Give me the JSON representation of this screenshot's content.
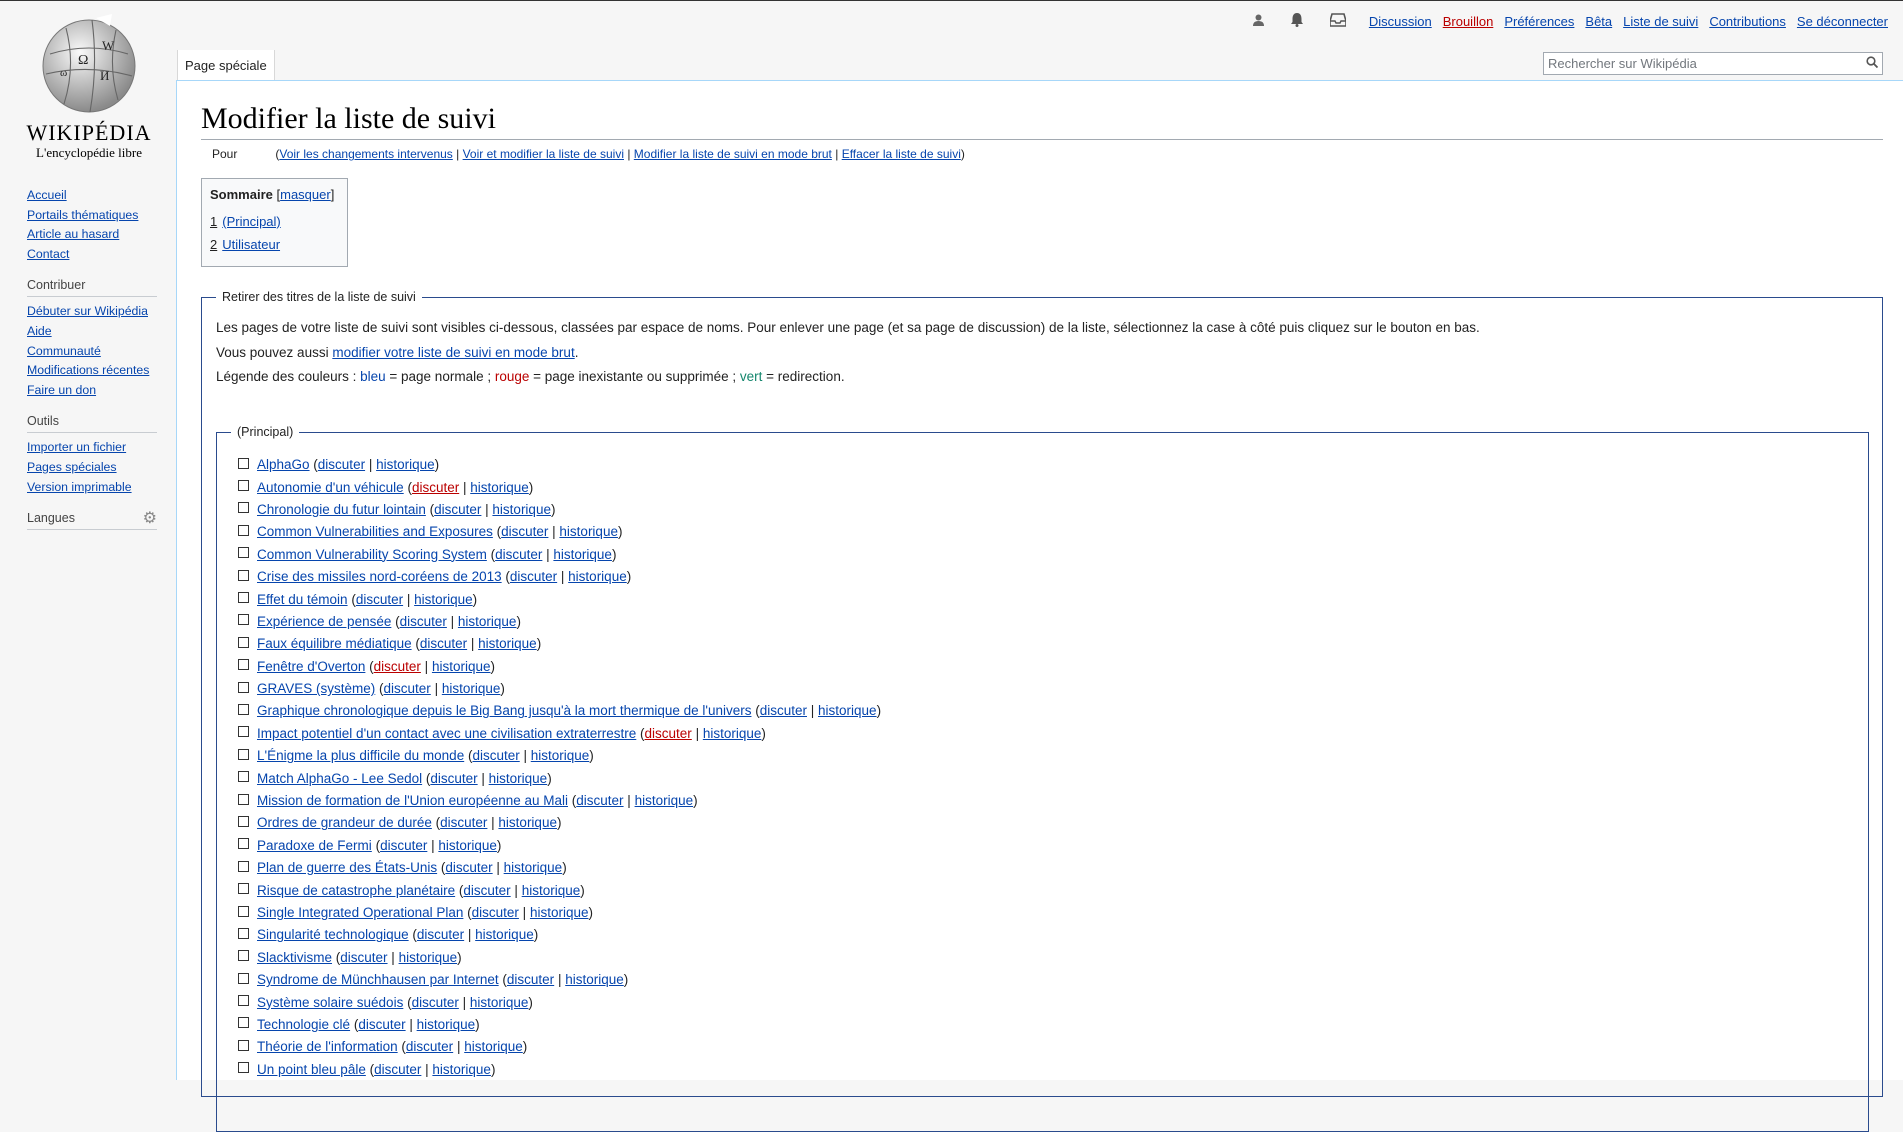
{
  "personal": {
    "items": [
      {
        "label": "Discussion",
        "red": false
      },
      {
        "label": "Brouillon",
        "red": true
      },
      {
        "label": "Préférences",
        "red": false
      },
      {
        "label": "Bêta",
        "red": false
      },
      {
        "label": "Liste de suivi",
        "red": false
      },
      {
        "label": "Contributions",
        "red": false
      },
      {
        "label": "Se déconnecter",
        "red": false
      }
    ]
  },
  "logo": {
    "wordmark": "WIKIPÉDIA",
    "tagline": "L'encyclopédie libre"
  },
  "sidebar": {
    "navigation": [
      "Accueil",
      "Portails thématiques",
      "Article au hasard",
      "Contact"
    ],
    "contribute": {
      "heading": "Contribuer",
      "items": [
        "Débuter sur Wikipédia",
        "Aide",
        "Communauté",
        "Modifications récentes",
        "Faire un don"
      ]
    },
    "tools": {
      "heading": "Outils",
      "items": [
        "Importer un fichier",
        "Pages spéciales",
        "Version imprimable"
      ]
    },
    "languages": {
      "heading": "Langues"
    }
  },
  "tabs": {
    "special": "Page spéciale"
  },
  "search": {
    "placeholder": "Rechercher sur Wikipédia"
  },
  "page": {
    "title": "Modifier la liste de suivi",
    "subnav": {
      "for": "Pour",
      "links": [
        "Voir les changements intervenus",
        "Voir et modifier la liste de suivi",
        "Modifier la liste de suivi en mode brut",
        "Effacer la liste de suivi"
      ]
    },
    "toc": {
      "title": "Sommaire",
      "toggle": "masquer",
      "items": [
        {
          "num": "1",
          "label": "(Principal)"
        },
        {
          "num": "2",
          "label": "Utilisateur"
        }
      ]
    },
    "remove": {
      "legend": "Retirer des titres de la liste de suivi",
      "intro": "Les pages de votre liste de suivi sont visibles ci-dessous, classées par espace de noms. Pour enlever une page (et sa page de discussion) de la liste, sélectionnez la case à côté puis cliquez sur le bouton en bas.",
      "raw_prefix": "Vous pouvez aussi ",
      "raw_link": "modifier votre liste de suivi en mode brut",
      "raw_suffix": ".",
      "legend_colors": {
        "prefix": "Légende des couleurs : ",
        "blue": "bleu",
        "blue_desc": " = page normale ; ",
        "red": "rouge",
        "red_desc": " = page inexistante ou supprimée ; ",
        "green": "vert",
        "green_desc": " = redirection."
      },
      "ns_legend": "(Principal)",
      "talk_label": "discuter",
      "history_label": "historique",
      "items": [
        {
          "title": "AlphaGo",
          "talk_red": false
        },
        {
          "title": "Autonomie d'un véhicule",
          "talk_red": true
        },
        {
          "title": "Chronologie du futur lointain",
          "talk_red": false
        },
        {
          "title": "Common Vulnerabilities and Exposures",
          "talk_red": false
        },
        {
          "title": "Common Vulnerability Scoring System",
          "talk_red": false
        },
        {
          "title": "Crise des missiles nord-coréens de 2013",
          "talk_red": false
        },
        {
          "title": "Effet du témoin",
          "talk_red": false
        },
        {
          "title": "Expérience de pensée",
          "talk_red": false
        },
        {
          "title": "Faux équilibre médiatique",
          "talk_red": false
        },
        {
          "title": "Fenêtre d'Overton",
          "talk_red": true
        },
        {
          "title": "GRAVES (système)",
          "talk_red": false
        },
        {
          "title": "Graphique chronologique depuis le Big Bang jusqu'à la mort thermique de l'univers",
          "talk_red": false
        },
        {
          "title": "Impact potentiel d'un contact avec une civilisation extraterrestre",
          "talk_red": true
        },
        {
          "title": "L'Énigme la plus difficile du monde",
          "talk_red": false
        },
        {
          "title": "Match AlphaGo - Lee Sedol",
          "talk_red": false
        },
        {
          "title": "Mission de formation de l'Union européenne au Mali",
          "talk_red": false
        },
        {
          "title": "Ordres de grandeur de durée",
          "talk_red": false
        },
        {
          "title": "Paradoxe de Fermi",
          "talk_red": false
        },
        {
          "title": "Plan de guerre des États-Unis",
          "talk_red": false
        },
        {
          "title": "Risque de catastrophe planétaire",
          "talk_red": false
        },
        {
          "title": "Single Integrated Operational Plan",
          "talk_red": false
        },
        {
          "title": "Singularité technologique",
          "talk_red": false
        },
        {
          "title": "Slacktivisme",
          "talk_red": false
        },
        {
          "title": "Syndrome de Münchhausen par Internet",
          "talk_red": false
        },
        {
          "title": "Système solaire suédois",
          "talk_red": false
        },
        {
          "title": "Technologie clé",
          "talk_red": false
        },
        {
          "title": "Théorie de l'information",
          "talk_red": false
        },
        {
          "title": "Un point bleu pâle",
          "talk_red": false
        }
      ]
    }
  }
}
